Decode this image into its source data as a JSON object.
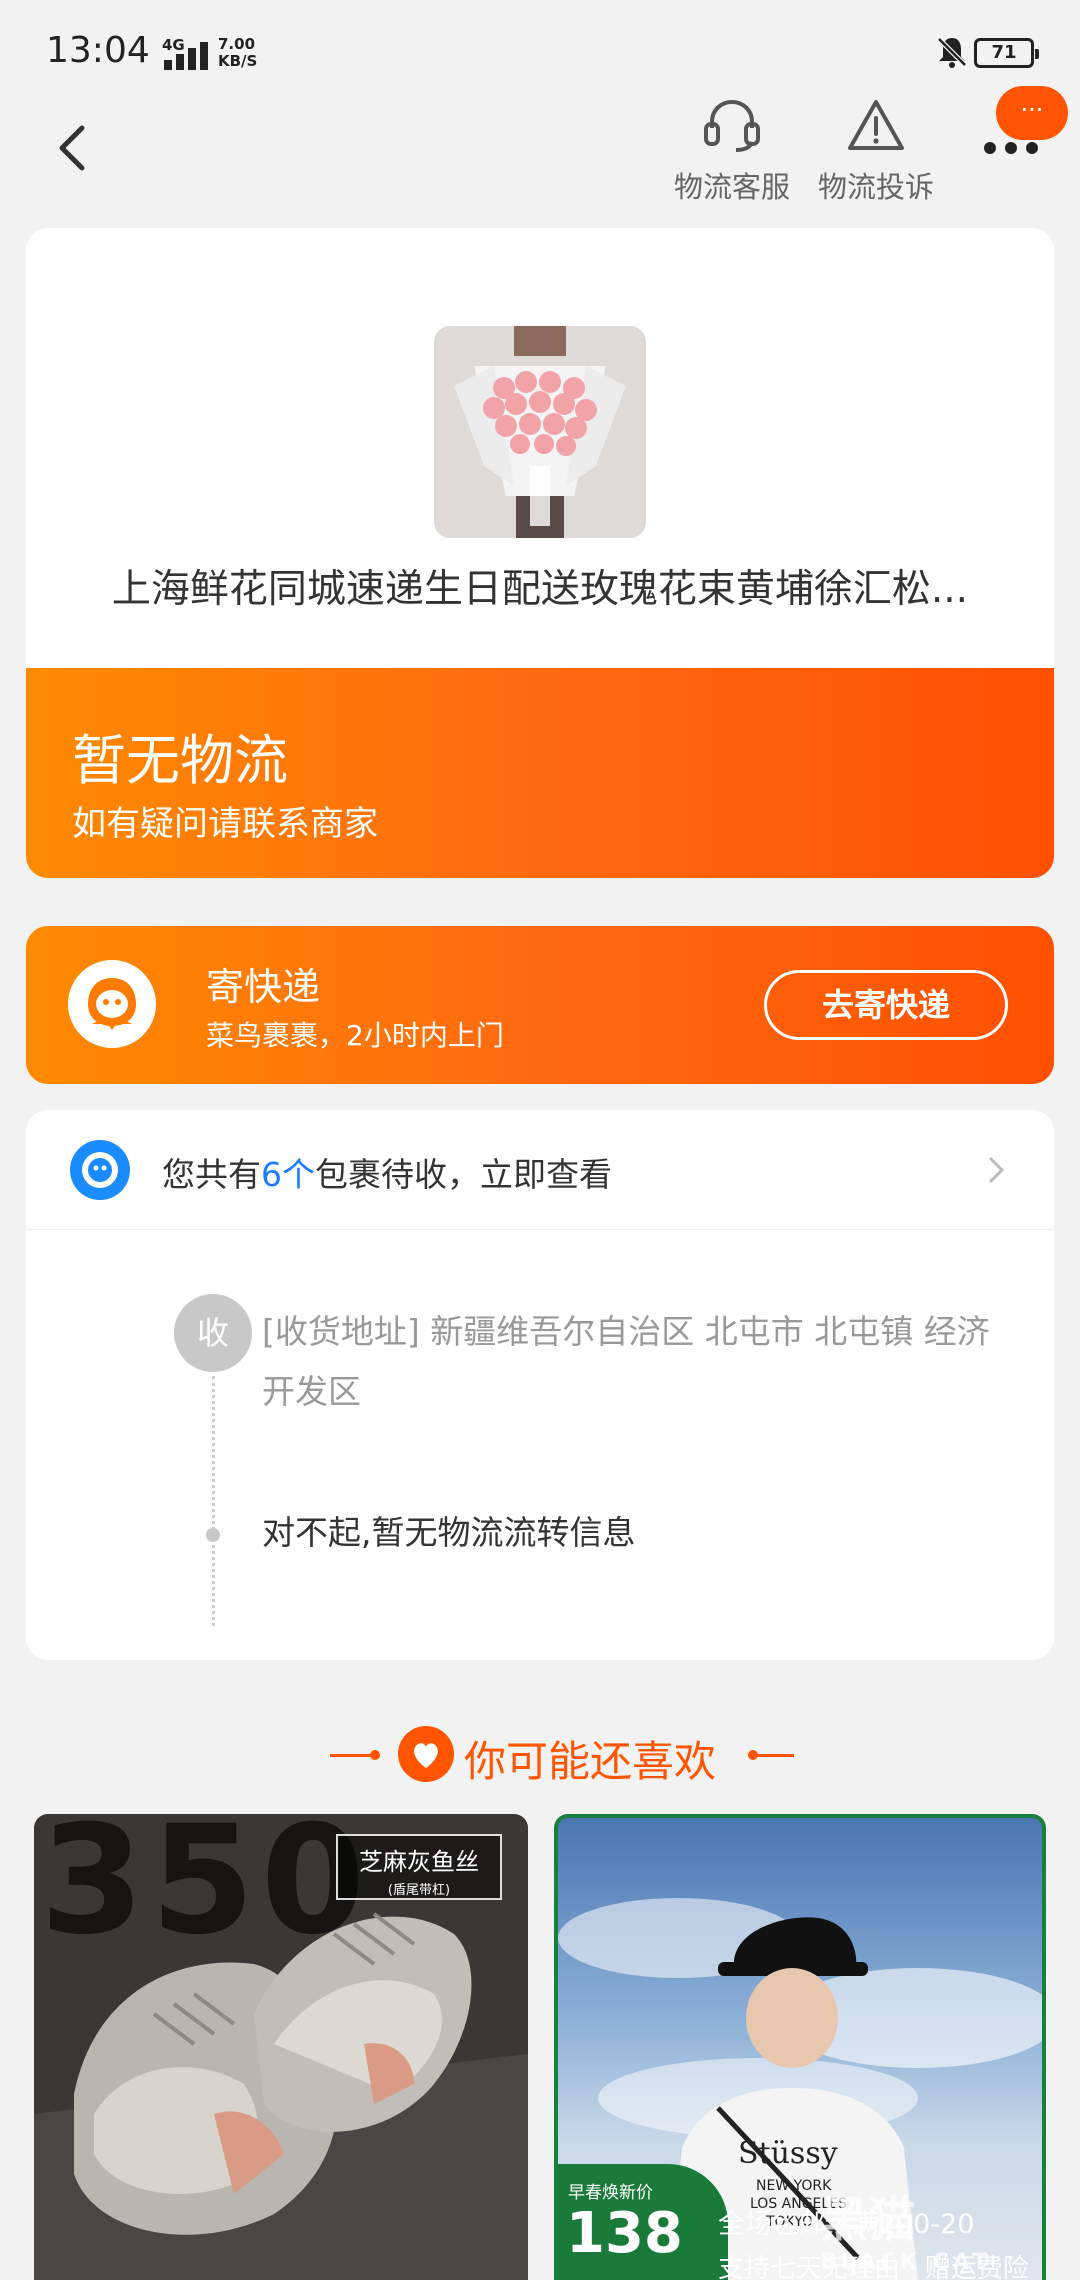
{
  "status_bar": {
    "time": "13:04",
    "network": "4G",
    "speed_value": "7.00",
    "speed_unit": "KB/S",
    "battery": "71"
  },
  "header": {
    "actions": [
      {
        "label": "物流客服",
        "icon": "headset-icon"
      },
      {
        "label": "物流投诉",
        "icon": "warning-icon"
      }
    ],
    "badge": "···"
  },
  "product": {
    "title": "上海鲜花同城速递生日配送玫瑰花束黄埔徐汇松..."
  },
  "logistics_status": {
    "title": "暂无物流",
    "subtitle": "如有疑问请联系商家"
  },
  "express": {
    "title": "寄快递",
    "subtitle": "菜鸟裹裹，2小时内上门",
    "button": "去寄快递"
  },
  "packages": {
    "prefix": "您共有",
    "count": "6个",
    "suffix": "包裹待收，立即查看"
  },
  "timeline": {
    "badge": "收",
    "address": "[收货地址] 新疆维吾尔自治区 北屯市 北屯镇 经济开发区",
    "no_info": "对不起,暂无物流流转信息"
  },
  "recommend": {
    "title": "你可能还喜欢",
    "items": [
      {
        "image_text": "350",
        "stamp_title": "芝麻灰鱼丝",
        "stamp_sub": "(盾尾带杠)"
      },
      {
        "price_label": "早春焕新价",
        "price": "138",
        "promo1": "全场包邮 · 满200-20",
        "promo2": "支持七天无理由 · 赠运费险"
      }
    ]
  },
  "watermark": {
    "main": "黑猫",
    "sub": "BLACK CAT"
  },
  "colors": {
    "accent": "#ff5500",
    "link": "#1a7cff",
    "green": "#1a7a3a"
  }
}
